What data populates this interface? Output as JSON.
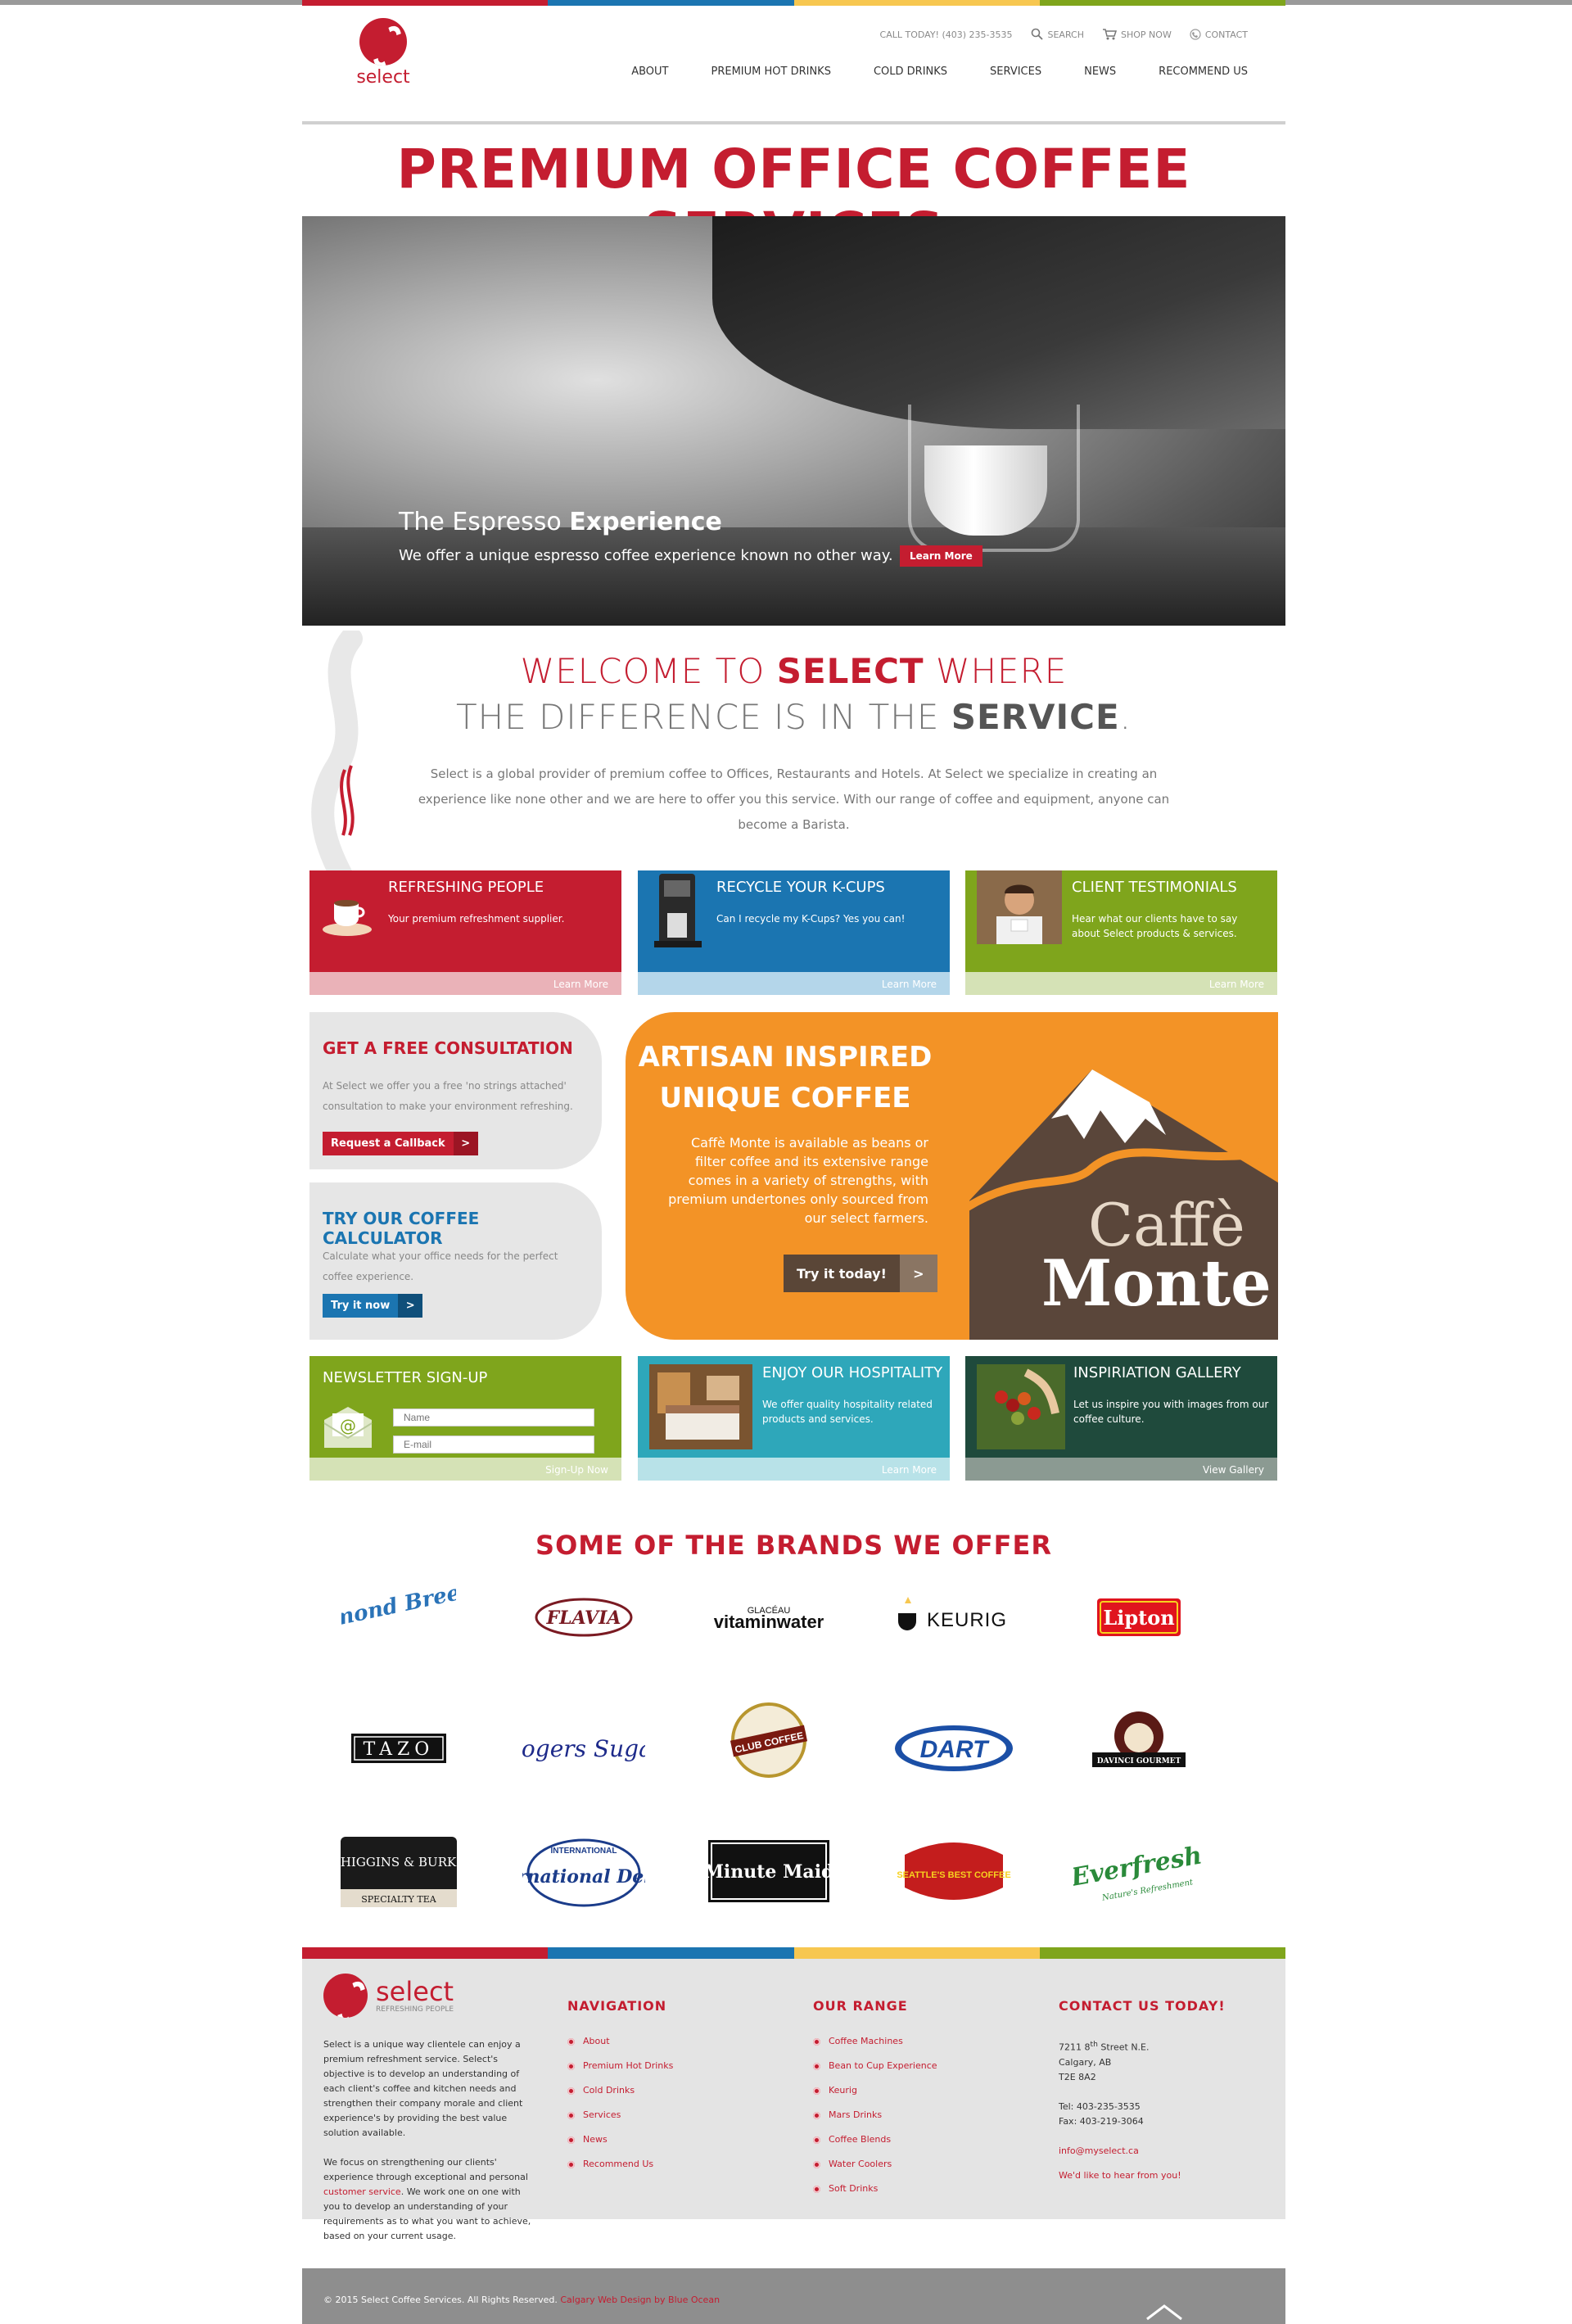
{
  "brand": {
    "name": "select",
    "tagline": "REFRESHING PEOPLE"
  },
  "colors": {
    "red": "#c41d30",
    "blue": "#1b75b1",
    "yellow": "#f7c750",
    "green": "#7fa51c",
    "orange": "#f39326",
    "teal": "#2ea7ba",
    "darkgreen": "#1f4a3c"
  },
  "utility": {
    "phone": "CALL TODAY! (403) 235-3535",
    "search": "SEARCH",
    "shop": "SHOP NOW",
    "contact": "CONTACT"
  },
  "nav": [
    "ABOUT",
    "PREMIUM HOT DRINKS",
    "COLD DRINKS",
    "SERVICES",
    "NEWS",
    "RECOMMEND US"
  ],
  "page_title": "PREMIUM OFFICE COFFEE SERVICES",
  "hero": {
    "title_pre": "The Espresso ",
    "title_bold": "Experience",
    "text": "We offer a unique espresso coffee experience known no other way.",
    "button": "Learn More"
  },
  "welcome": {
    "l1_a": "WELCOME TO ",
    "l1_b": "SELECT",
    "l1_c": " WHERE",
    "l2_a": "THE DIFFERENCE IS IN THE ",
    "l2_b": "SERVICE",
    "l2_c": "."
  },
  "intro": "Select is a global provider of premium coffee to Offices, Restaurants and Hotels. At Select we specialize in creating an experience like none other and we are here to offer you this service. With our range of coffee and equipment, anyone can become a Barista.",
  "tiles_row1": [
    {
      "title": "REFRESHING PEOPLE",
      "desc": "Your premium refreshment supplier.",
      "link": "Learn More"
    },
    {
      "title": "RECYCLE YOUR K-CUPS",
      "desc": "Can I recycle my K-Cups? Yes you can!",
      "link": "Learn More"
    },
    {
      "title": "CLIENT TESTIMONIALS",
      "desc": "Hear what our clients have to say about Select products & services.",
      "link": "Learn More"
    }
  ],
  "consult": {
    "title": "GET A FREE CONSULTATION",
    "text": "At Select we offer you a free 'no strings attached' consultation to make your environment refreshing.",
    "button": "Request a Callback",
    "arrow": ">"
  },
  "calculator": {
    "title": "TRY OUR COFFEE CALCULATOR",
    "text": "Calculate what your office needs for the perfect coffee experience.",
    "button": "Try it now",
    "arrow": ">"
  },
  "artisan": {
    "title_l1": "ARTISAN INSPIRED",
    "title_l2": "UNIQUE COFFEE",
    "text": "Caffè Monte is available as beans or filter coffee and its extensive range comes in a variety of strengths, with premium undertones only sourced from our select farmers.",
    "button": "Try it today!",
    "arrow": ">",
    "logo_l1": "Caffè",
    "logo_l2": "Monte"
  },
  "newsletter": {
    "title": "NEWSLETTER SIGN-UP",
    "name_ph": "Name",
    "email_ph": "E-mail",
    "link": "Sign-Up Now"
  },
  "tiles_row3": [
    {
      "title": "ENJOY OUR HOSPITALITY",
      "desc": "We offer quality hospitality related products and services.",
      "link": "Learn More"
    },
    {
      "title": "INSPIRIATION GALLERY",
      "desc": "Let us inspire you with images from our coffee culture.",
      "link": "View Gallery"
    }
  ],
  "brands_title": "SOME OF THE BRANDS WE OFFER",
  "brands": [
    "Almond Breeze",
    "FLAVIA",
    "vitaminwater",
    "KEURIG",
    "Lipton",
    "TAZO",
    "Rogers Sugar",
    "CLUB COFFEE",
    "DART",
    "DAVINCI GOURMET",
    "HIGGINS & BURKE",
    "International Delight",
    "Minute Maid",
    "SEATTLE'S BEST COFFEE",
    "Everfresh"
  ],
  "brand_extra": {
    "glaceau": "GLACÉAU",
    "higgins_sub": "SPECIALTY TEA",
    "intl": "INTERNATIONAL",
    "everfresh_sub": "Nature's Refreshment"
  },
  "footer": {
    "about_p1": "Select is a unique way clientele can enjoy a premium refreshment service. Select's objective is to develop an understanding of each client's coffee and kitchen needs and strengthen their company morale and client experience's by providing the best value solution available.",
    "about_p2_a": "We focus on strengthening our clients' experience through exceptional and personal ",
    "about_p2_link": "customer service",
    "about_p2_b": ". We work one on one with you to develop an understanding of your requirements as to what you want to achieve, based on your current usage.",
    "nav_title": "NAVIGATION",
    "nav": [
      "About",
      "Premium Hot Drinks",
      "Cold Drinks",
      "Services",
      "News",
      "Recommend Us"
    ],
    "range_title": "OUR RANGE",
    "range": [
      "Coffee Machines",
      "Bean to Cup Experience",
      "Keurig",
      "Mars Drinks",
      "Coffee Blends",
      "Water Coolers",
      "Soft Drinks"
    ],
    "contact_title": "CONTACT US TODAY!",
    "addr1_a": "7211 8",
    "addr1_sup": "th",
    "addr1_b": " Street N.E.",
    "addr2": "Calgary, AB",
    "addr3": "T2E 8A2",
    "tel": "Tel: 403-235-3535",
    "fax": "Fax: 403-219-3064",
    "email": "info@myselect.ca",
    "hear": "We'd like to hear from you!"
  },
  "copyright": "© 2015 Select Coffee Services. All Rights Reserved.",
  "credit": "Calgary Web Design by Blue Ocean"
}
